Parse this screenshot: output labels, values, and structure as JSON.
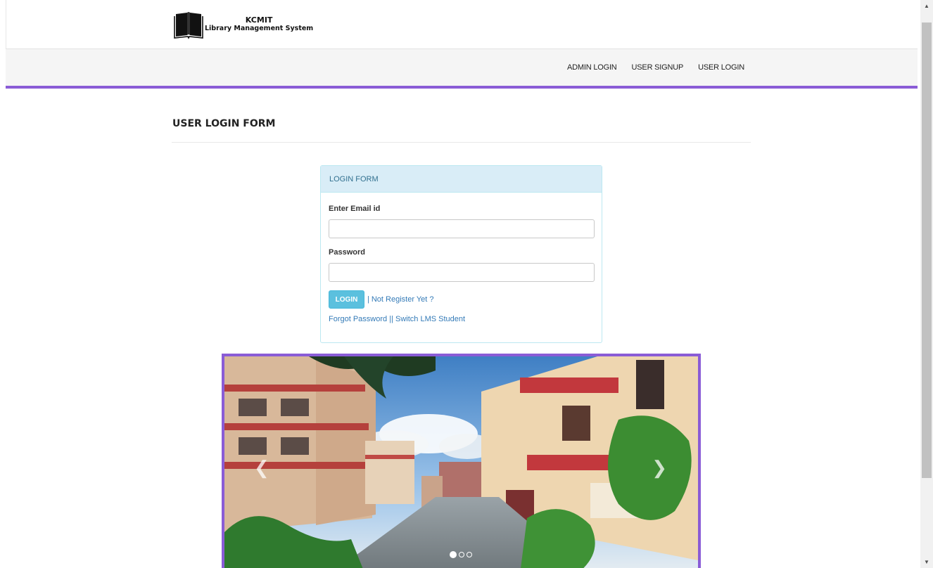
{
  "brand": {
    "title": "KCMIT",
    "subtitle": "Library Management System",
    "logo_icon": "open-book-icon"
  },
  "nav": {
    "items": [
      {
        "label": "ADMIN LOGIN"
      },
      {
        "label": "USER SIGNUP"
      },
      {
        "label": "USER LOGIN"
      }
    ]
  },
  "page": {
    "heading": "USER LOGIN FORM"
  },
  "login_form": {
    "panel_title": "LOGIN FORM",
    "email_label": "Enter Email id",
    "email_value": "",
    "password_label": "Password",
    "password_value": "",
    "login_button": "LOGIN",
    "separator": "|",
    "register_link": "Not Register Yet ?",
    "forgot_link": "Forgot Password",
    "forgot_separator": "||",
    "switch_link": "Switch LMS Student"
  },
  "carousel": {
    "prev_icon": "chevron-left-icon",
    "next_icon": "chevron-right-icon",
    "slide_count": 3,
    "active_index": 0
  },
  "colors": {
    "accent": "#8a5cd6",
    "panel_head_bg": "#d9edf7",
    "panel_border": "#bce8f1",
    "button": "#5bc0de",
    "link": "#337ab7"
  }
}
